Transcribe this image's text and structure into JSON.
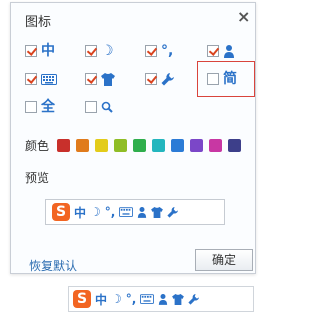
{
  "dialog": {
    "title": "图标",
    "close": "×",
    "colors_label": "颜色",
    "preview_label": "预览",
    "restore_label": "恢复默认",
    "ok_label": "确定"
  },
  "options": [
    {
      "id": "chinese",
      "checked": true,
      "glyph": "中",
      "icon": "chinese-char-icon"
    },
    {
      "id": "halfwidth",
      "checked": true,
      "glyph": "☽",
      "icon": "moon-icon"
    },
    {
      "id": "punct",
      "checked": true,
      "glyph": "°,",
      "icon": "punctuation-icon"
    },
    {
      "id": "user",
      "checked": true,
      "glyph": "👤",
      "icon": "user-icon"
    },
    {
      "id": "keyboard",
      "checked": true,
      "glyph": "⌨",
      "icon": "keyboard-icon"
    },
    {
      "id": "skin",
      "checked": true,
      "glyph": "👕",
      "icon": "shirt-icon"
    },
    {
      "id": "tools",
      "checked": true,
      "glyph": "🔧",
      "icon": "wrench-icon"
    },
    {
      "id": "simplified",
      "checked": false,
      "glyph": "简",
      "icon": "simplified-char-icon"
    },
    {
      "id": "fullwidth",
      "checked": false,
      "glyph": "全",
      "icon": "fullwidth-char-icon"
    },
    {
      "id": "search",
      "checked": false,
      "glyph": "🔍",
      "icon": "search-icon"
    }
  ],
  "colors": [
    "#c8302b",
    "#e07b1c",
    "#e3cc1a",
    "#8fbd26",
    "#2fae4c",
    "#23b6be",
    "#2b7bd6",
    "#7b47c8",
    "#c837a3",
    "#3d3f8a"
  ],
  "preview": {
    "logo": "S",
    "glyphs": [
      "中",
      "☽",
      "°,",
      "⌨",
      "👤",
      "👕",
      "🔧"
    ]
  }
}
